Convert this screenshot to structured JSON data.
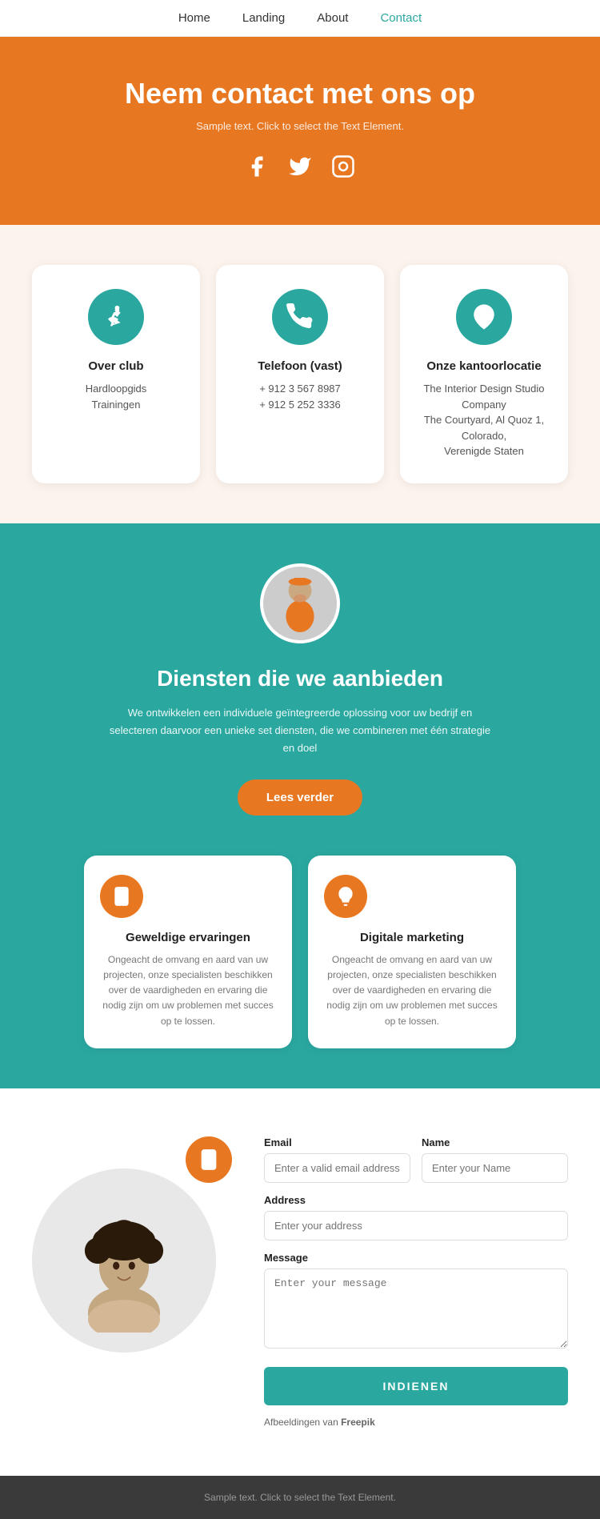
{
  "nav": {
    "items": [
      {
        "label": "Home",
        "active": false
      },
      {
        "label": "Landing",
        "active": false
      },
      {
        "label": "About",
        "active": false
      },
      {
        "label": "Contact",
        "active": true
      }
    ]
  },
  "hero": {
    "title": "Neem contact met ons op",
    "subtitle": "Sample text. Click to select the Text Element.",
    "social_icons": [
      "facebook",
      "twitter",
      "instagram"
    ]
  },
  "cards": [
    {
      "title": "Over club",
      "lines": [
        "Hardloopgids",
        "Trainingen"
      ],
      "icon": "runner"
    },
    {
      "title": "Telefoon (vast)",
      "lines": [
        "+ 912 3 567 8987",
        "+ 912 5 252 3336"
      ],
      "icon": "phone"
    },
    {
      "title": "Onze kantoorlocatie",
      "lines": [
        "The Interior Design Studio Company",
        "The Courtyard, Al Quoz 1, Colorado,",
        "Verenigde Staten"
      ],
      "icon": "location"
    }
  ],
  "teal_section": {
    "title": "Diensten die we aanbieden",
    "description": "We ontwikkelen een individuele geïntegreerde oplossing voor uw bedrijf en selecteren daarvoor een unieke set diensten, die we combineren met één strategie en doel",
    "button_label": "Lees verder"
  },
  "services": [
    {
      "title": "Geweldige ervaringen",
      "description": "Ongeacht de omvang en aard van uw projecten, onze specialisten beschikken over de vaardigheden en ervaring die nodig zijn om uw problemen met succes op te lossen.",
      "icon": "mobile"
    },
    {
      "title": "Digitale marketing",
      "description": "Ongeacht de omvang en aard van uw projecten, onze specialisten beschikken over de vaardigheden en ervaring die nodig zijn om uw problemen met succes op te lossen.",
      "icon": "bulb"
    }
  ],
  "contact_form": {
    "email_label": "Email",
    "email_placeholder": "Enter a valid email address",
    "name_label": "Name",
    "name_placeholder": "Enter your Name",
    "address_label": "Address",
    "address_placeholder": "Enter your address",
    "message_label": "Message",
    "message_placeholder": "Enter your message",
    "submit_label": "INDIENEN",
    "freepik_text": "Afbeeldingen van ",
    "freepik_brand": "Freepik"
  },
  "footer": {
    "text": "Sample text. Click to select the Text Element."
  }
}
